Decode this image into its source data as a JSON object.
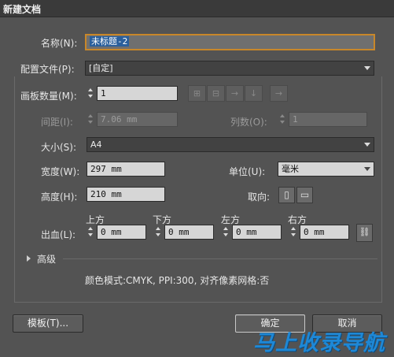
{
  "window": {
    "title": "新建文档"
  },
  "name": {
    "label": "名称(N):",
    "value": "未标题-2"
  },
  "profile": {
    "label": "配置文件(P):",
    "value": "[自定]"
  },
  "artboards": {
    "label": "画板数量(M):",
    "value": "1"
  },
  "spacing": {
    "label": "间距(I):",
    "value": "7.06 mm"
  },
  "columns": {
    "label": "列数(O):",
    "value": "1"
  },
  "size": {
    "label": "大小(S):",
    "value": "A4"
  },
  "width": {
    "label": "宽度(W):",
    "value": "297 mm"
  },
  "units": {
    "label": "单位(U):",
    "value": "毫米"
  },
  "height": {
    "label": "高度(H):",
    "value": "210 mm"
  },
  "orientation": {
    "label": "取向:"
  },
  "bleed": {
    "label": "出血(L):",
    "top": {
      "label": "上方",
      "value": "0 mm"
    },
    "bottom": {
      "label": "下方",
      "value": "0 mm"
    },
    "left": {
      "label": "左方",
      "value": "0 mm"
    },
    "right": {
      "label": "右方",
      "value": "0 mm"
    }
  },
  "advanced": {
    "label": "高级"
  },
  "summary": "颜色模式:CMYK, PPI:300, 对齐像素网格:否",
  "buttons": {
    "templates": "模板(T)...",
    "ok": "确定",
    "cancel": "取消"
  },
  "watermark": "马上收录导航",
  "icons": [
    "arrange-grid-by-row-icon",
    "arrange-grid-by-column-icon",
    "arrange-by-row-icon",
    "arrange-by-column-icon",
    "rtl-layout-icon",
    "portrait-icon",
    "landscape-icon",
    "link-icon"
  ],
  "colors": {
    "dialog_bg": "#535353",
    "focus_border": "#c8872a",
    "selection": "#2a5f9c",
    "watermark": "#1e88d6"
  }
}
